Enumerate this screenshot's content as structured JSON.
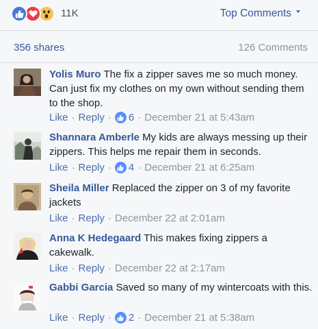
{
  "header": {
    "reaction_count": "11K",
    "reactions": [
      "like-icon",
      "love-icon",
      "wow-icon"
    ],
    "top_comments_label": "Top Comments"
  },
  "stats": {
    "shares": "356 shares",
    "comments": "126 Comments"
  },
  "comments": [
    {
      "author": "Yolis Muro",
      "text": "The fix a zipper saves me so much money. Can just fix my clothes on my own without sending them to the shop.",
      "like": "Like",
      "reply": "Reply",
      "reactions": "6",
      "date": "December 21 at 5:43am"
    },
    {
      "author": "Shannara Amberle",
      "text": "My kids are always messing up their zippers. This helps me repair them in seconds.",
      "like": "Like",
      "reply": "Reply",
      "reactions": "4",
      "date": "December 21 at 6:25am"
    },
    {
      "author": "Sheila Miller",
      "text": "Replaced the zipper on 3 of my favorite jackets",
      "like": "Like",
      "reply": "Reply",
      "reactions": "",
      "date": "December 22 at 2:01am"
    },
    {
      "author": "Anna K Hedegaard",
      "text": "This makes fixing zippers a cakewalk.",
      "like": "Like",
      "reply": "Reply",
      "reactions": "",
      "date": "December 22 at 2:17am"
    },
    {
      "author": "Gabbi Garcia",
      "text": "Saved so many of my wintercoats with this.",
      "like": "Like",
      "reply": "Reply",
      "reactions": "2",
      "date": "December 21 at 5:38am"
    }
  ],
  "colors": {
    "link": "#365899",
    "muted": "#90949c",
    "like_blue": "#5890ff",
    "love_red": "#f0384e",
    "wow_yellow": "#f7c447"
  }
}
